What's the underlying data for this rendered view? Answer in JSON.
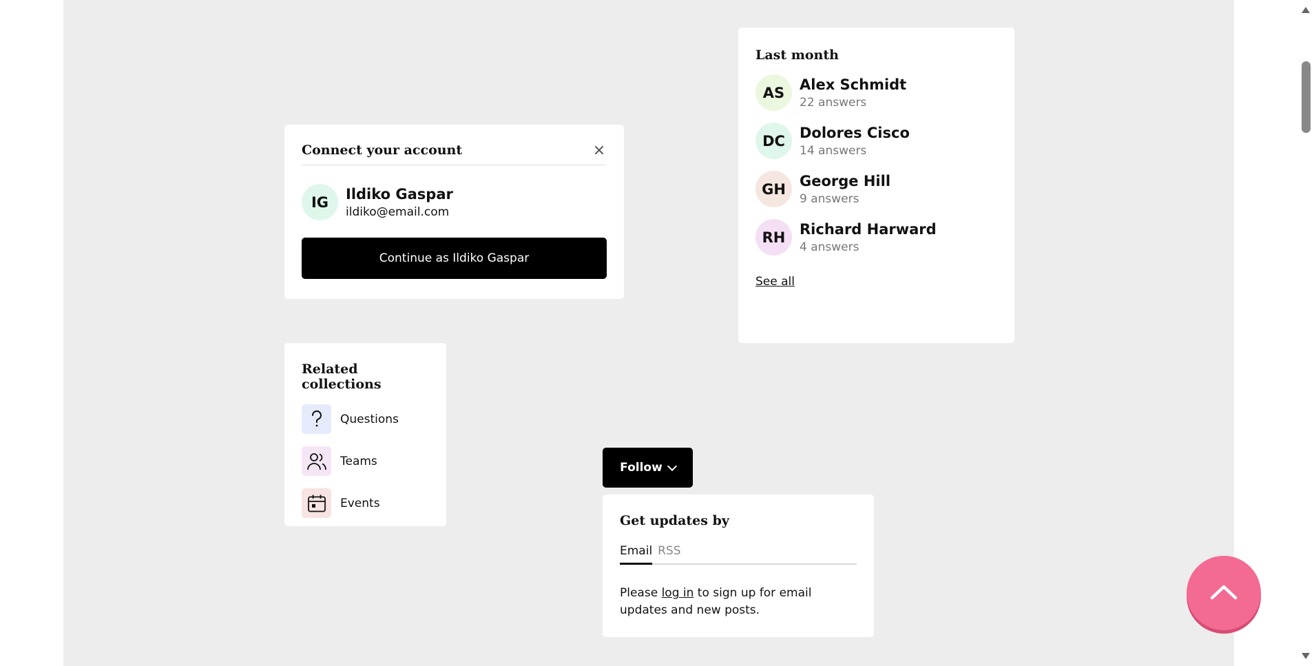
{
  "connect": {
    "title": "Connect your account",
    "initials": "IG",
    "name": "Ildiko Gaspar",
    "email": "ildiko@email.com",
    "button": "Continue as Ildiko Gaspar",
    "avatar_color": "#dff7ea"
  },
  "last_month": {
    "title": "Last month",
    "people": [
      {
        "initials": "AS",
        "name": "Alex Schmidt",
        "count": "22 answers",
        "color": "#ecf7df"
      },
      {
        "initials": "DC",
        "name": "Dolores Cisco",
        "count": "14 answers",
        "color": "#dff7ea"
      },
      {
        "initials": "GH",
        "name": "George Hill",
        "count": "9 answers",
        "color": "#f5e6df"
      },
      {
        "initials": "RH",
        "name": "Richard Harward",
        "count": "4 answers",
        "color": "#f5dff4"
      }
    ],
    "see_all": "See all"
  },
  "related": {
    "title": "Related collections",
    "items": [
      {
        "label": "Questions",
        "icon": "question-icon",
        "color": "#e5ebfa"
      },
      {
        "label": "Teams",
        "icon": "users-icon",
        "color": "#f5e6f6"
      },
      {
        "label": "Events",
        "icon": "calendar-icon",
        "color": "#f8e3e3"
      }
    ]
  },
  "follow": {
    "label": "Follow",
    "icon": "chevron-down-icon"
  },
  "updates": {
    "title": "Get updates by",
    "tabs": [
      "Email",
      "RSS"
    ],
    "msg_before": "Please ",
    "msg_link": "log in",
    "msg_after": " to sign up for email updates and new posts."
  },
  "colors": {
    "background": "#ededed",
    "accent": "#f36a92",
    "primary_button": "#000000"
  }
}
